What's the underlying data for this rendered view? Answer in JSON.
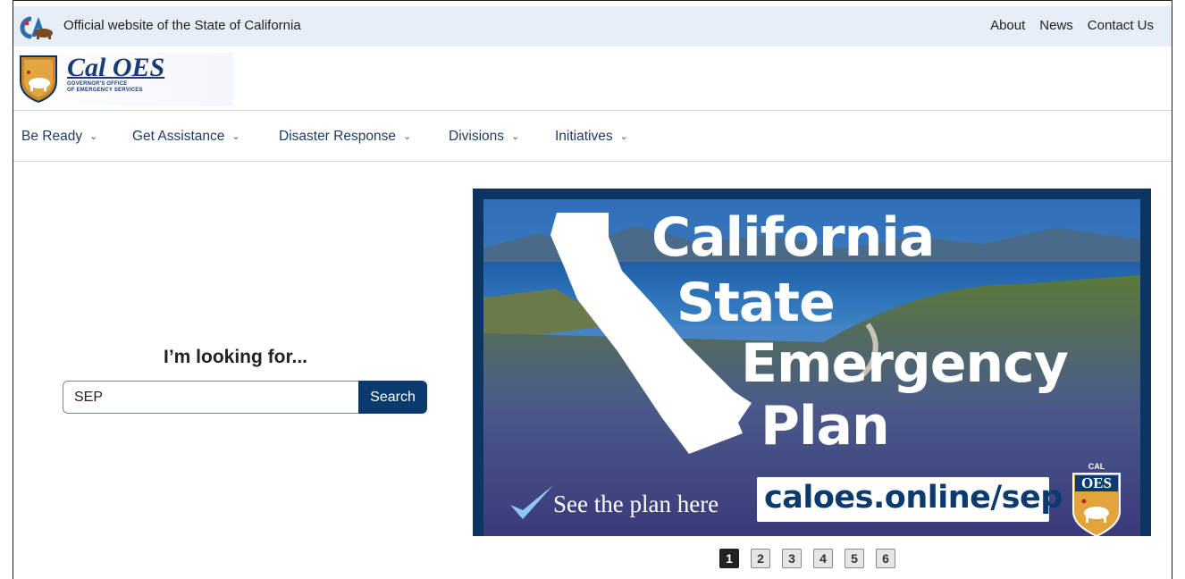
{
  "utility_bar": {
    "official_text": "Official website of the State of California",
    "links": [
      "About",
      "News",
      "Contact Us"
    ]
  },
  "brand": {
    "name": "Cal OES",
    "subtitle_line1": "GOVERNOR'S OFFICE",
    "subtitle_line2": "OF EMERGENCY SERVICES"
  },
  "nav": {
    "items": [
      "Be Ready",
      "Get Assistance",
      "Disaster Response",
      "Divisions",
      "Initiatives"
    ]
  },
  "search": {
    "heading": "I’m looking for...",
    "value": "SEP",
    "button_label": "Search"
  },
  "banner": {
    "title_line1": "California",
    "title_line2": "State",
    "title_line3": "Emergency",
    "title_line4": "Plan",
    "cta": "See the plan here",
    "url": "caloes.online/sep",
    "badge_top": "CAL",
    "badge_text": "OES"
  },
  "carousel": {
    "pages": [
      "1",
      "2",
      "3",
      "4",
      "5",
      "6"
    ],
    "active_page": 1
  },
  "colors": {
    "utility_bg": "#e6eef8",
    "nav_text": "#1f3a5f",
    "search_button": "#0b3a6e",
    "banner_border": "#0d3563",
    "brand_blue": "#1c3a7a"
  }
}
